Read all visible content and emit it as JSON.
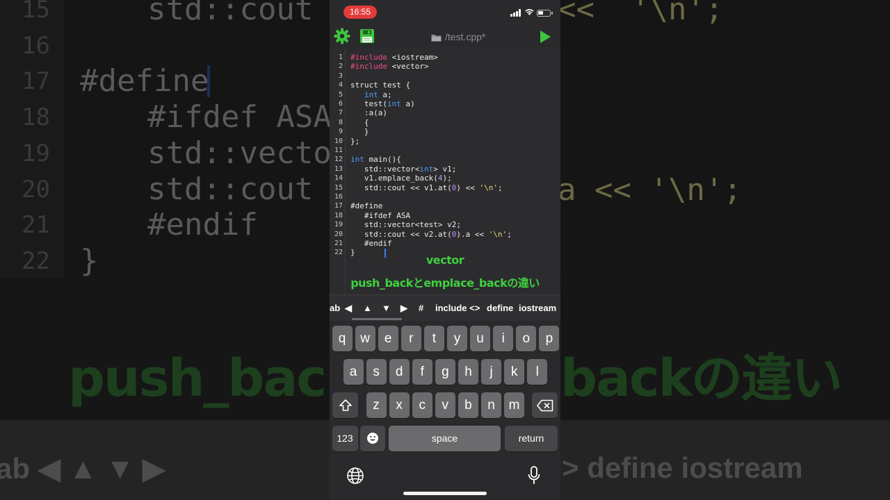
{
  "background": {
    "code_lines": [
      {
        "num": "15",
        "text": "std::cout"
      },
      {
        "num": "16",
        "text": ""
      },
      {
        "num": "17",
        "text": "#define"
      },
      {
        "num": "18",
        "text": "#ifdef ASA"
      },
      {
        "num": "19",
        "text": "std::vecto"
      },
      {
        "num": "20",
        "text": "std::cout"
      },
      {
        "num": "21",
        "text": "#endif"
      },
      {
        "num": "22",
        "text": "}"
      }
    ],
    "right_fragment_top": "<<  '\\n';",
    "right_fragment_mid": "a << '\\n';",
    "caption_left": "push_backと",
    "caption_right": "backの違い",
    "toolbar_left": "ab  ◀   ▲   ▼   ▶",
    "toolbar_right": ">  define  iostream"
  },
  "status": {
    "time": "16:55",
    "wifi_icon": "wifi-icon",
    "battery_icon": "battery-icon"
  },
  "toolbar": {
    "settings_icon": "gear-icon",
    "save_icon": "floppy-icon",
    "file_title": "/test.cpp*",
    "run_icon": "play-icon",
    "accent": "#3fc43f"
  },
  "editor": {
    "lines": [
      {
        "num": "1",
        "html_parts": [
          [
            "pp",
            "#include"
          ],
          [
            "",
            " <iostream>"
          ]
        ]
      },
      {
        "num": "2",
        "html_parts": [
          [
            "pp",
            "#include"
          ],
          [
            "",
            " <vector>"
          ]
        ]
      },
      {
        "num": "3",
        "html_parts": []
      },
      {
        "num": "4",
        "html_parts": [
          [
            "",
            "struct test {"
          ]
        ]
      },
      {
        "num": "5",
        "html_parts": [
          [
            "",
            "   "
          ],
          [
            "kw",
            "int"
          ],
          [
            "",
            " a;"
          ]
        ]
      },
      {
        "num": "6",
        "html_parts": [
          [
            "",
            "   test("
          ],
          [
            "kw",
            "int"
          ],
          [
            "",
            " a)"
          ]
        ]
      },
      {
        "num": "7",
        "html_parts": [
          [
            "",
            "   :a(a)"
          ]
        ]
      },
      {
        "num": "8",
        "html_parts": [
          [
            "",
            "   {"
          ]
        ]
      },
      {
        "num": "9",
        "html_parts": [
          [
            "",
            "   }"
          ]
        ]
      },
      {
        "num": "10",
        "html_parts": [
          [
            "",
            "};"
          ]
        ]
      },
      {
        "num": "11",
        "html_parts": []
      },
      {
        "num": "12",
        "html_parts": [
          [
            "kw",
            "int"
          ],
          [
            "",
            " main(){"
          ]
        ]
      },
      {
        "num": "13",
        "html_parts": [
          [
            "",
            "   std::vector<"
          ],
          [
            "kw",
            "int"
          ],
          [
            "",
            "> v1;"
          ]
        ]
      },
      {
        "num": "14",
        "html_parts": [
          [
            "",
            "   v1.emplace_back("
          ],
          [
            "nm",
            "4"
          ],
          [
            "",
            ");"
          ]
        ]
      },
      {
        "num": "15",
        "html_parts": [
          [
            "",
            "   std::cout << v1.at("
          ],
          [
            "nm",
            "0"
          ],
          [
            "",
            ") << "
          ],
          [
            "st",
            "'\\n'"
          ],
          [
            "",
            ";"
          ]
        ]
      },
      {
        "num": "16",
        "html_parts": []
      },
      {
        "num": "17",
        "html_parts": [
          [
            "",
            "#define"
          ]
        ]
      },
      {
        "num": "18",
        "html_parts": [
          [
            "",
            "   #ifdef ASA"
          ]
        ]
      },
      {
        "num": "19",
        "html_parts": [
          [
            "",
            "   std::vector<test> v2;"
          ]
        ]
      },
      {
        "num": "20",
        "html_parts": [
          [
            "",
            "   std::cout << v2.at("
          ],
          [
            "nm",
            "0"
          ],
          [
            "",
            ").a << "
          ],
          [
            "st",
            "'\\n'"
          ],
          [
            "",
            ";"
          ]
        ]
      },
      {
        "num": "21",
        "html_parts": [
          [
            "",
            "   #endif"
          ]
        ]
      },
      {
        "num": "22",
        "html_parts": [
          [
            "",
            "}"
          ]
        ]
      }
    ]
  },
  "caption": {
    "line1": "vector",
    "line2": "push_backとemplace_backの違い"
  },
  "accessory_bar": {
    "items": [
      "ab",
      "◀",
      "▲",
      "▼",
      "▶",
      "#",
      "include <>",
      "define",
      "iostream"
    ]
  },
  "keyboard": {
    "row1": [
      "q",
      "w",
      "e",
      "r",
      "t",
      "y",
      "u",
      "i",
      "o",
      "p"
    ],
    "row2": [
      "a",
      "s",
      "d",
      "f",
      "g",
      "h",
      "j",
      "k",
      "l"
    ],
    "row3": [
      "z",
      "x",
      "c",
      "v",
      "b",
      "n",
      "m"
    ],
    "shift_icon": "shift-icon",
    "delete_icon": "delete-icon",
    "numbers_label": "123",
    "emoji_icon": "emoji-icon",
    "space_label": "space",
    "return_label": "return",
    "globe_icon": "globe-icon",
    "mic_icon": "microphone-icon"
  }
}
